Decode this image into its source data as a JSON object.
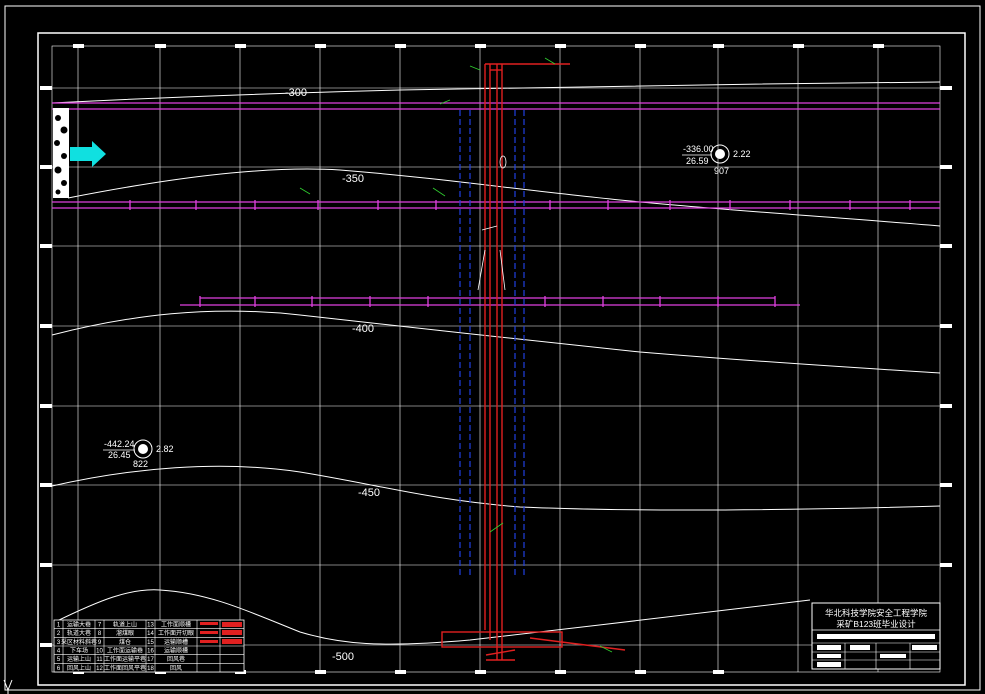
{
  "contours": [
    {
      "label": "-300"
    },
    {
      "label": "-350"
    },
    {
      "label": "-400"
    },
    {
      "label": "-450"
    },
    {
      "label": "-500"
    }
  ],
  "boreholes": [
    {
      "elevation": "-336.00",
      "thickness": "26.59",
      "coal": "2.22",
      "id": "907"
    },
    {
      "elevation": "-442.24",
      "thickness": "26.45",
      "coal": "2.82",
      "id": "822"
    }
  ],
  "title_block": {
    "line1": "华北科技学院安全工程学院",
    "line2": "采矿B123班毕业设计"
  },
  "legend_rows": [
    [
      "1",
      "运输大巷",
      "7",
      "轨道上山",
      "13",
      "工作面顺槽"
    ],
    [
      "2",
      "轨道大巷",
      "8",
      "溜煤眼",
      "14",
      "工作面开切眼"
    ],
    [
      "3",
      "采区材料斜巷",
      "9",
      "煤仓",
      "15",
      "运输顺槽"
    ],
    [
      "4",
      "下车场",
      "10",
      "工作面运输巷",
      "16",
      "运输顺槽"
    ],
    [
      "5",
      "运输上山",
      "11",
      "工作面运输平巷",
      "17",
      "回风巷"
    ],
    [
      "6",
      "回风上山",
      "12",
      "工作面回风平巷",
      "18",
      "回风"
    ]
  ],
  "colors": {
    "background": "#000000",
    "contour": "#ffffff",
    "roadway_magenta": "#e040e0",
    "shaft_red": "#e02020",
    "dashed_blue": "#2040e0",
    "arrow_cyan": "#10e0e0",
    "grid": "#ffffff"
  }
}
